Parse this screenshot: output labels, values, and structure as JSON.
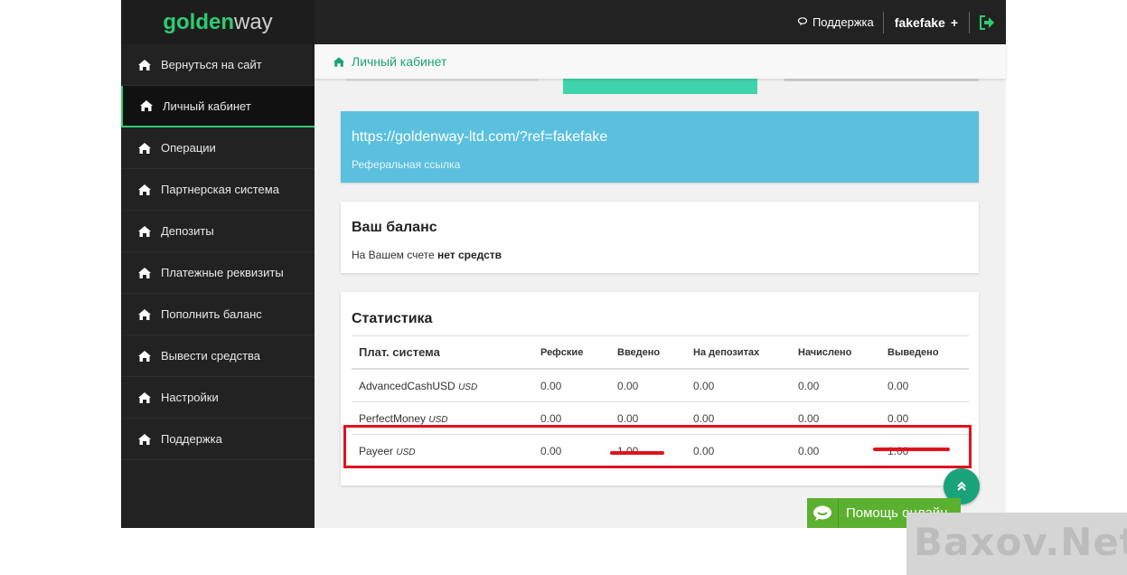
{
  "logo": {
    "part1": "golden",
    "part2": "way"
  },
  "header": {
    "support_label": "Поддержка",
    "username": "fakefake",
    "plus": "+"
  },
  "sidebar": {
    "items": [
      {
        "label": "Вернуться на сайт"
      },
      {
        "label": "Личный кабинет"
      },
      {
        "label": "Операции"
      },
      {
        "label": "Партнерская система"
      },
      {
        "label": "Депозиты"
      },
      {
        "label": "Платежные реквизиты"
      },
      {
        "label": "Пополнить баланс"
      },
      {
        "label": "Вывести средства"
      },
      {
        "label": "Настройки"
      },
      {
        "label": "Поддержка"
      }
    ]
  },
  "breadcrumb": {
    "label": "Личный кабинет"
  },
  "referral": {
    "url": "https://goldenway-ltd.com/?ref=fakefake",
    "label": "Реферальная ссылка"
  },
  "balance": {
    "title": "Ваш баланс",
    "text": "На Вашем счете",
    "value": "нет средств"
  },
  "stats": {
    "title": "Статистика",
    "headers": [
      "Плат. система",
      "Рефские",
      "Введено",
      "На депозитах",
      "Начислено",
      "Выведено"
    ],
    "rows": [
      {
        "system": "AdvancedCashUSD",
        "currency": "USD",
        "values": [
          "0.00",
          "0.00",
          "0.00",
          "0.00",
          "0.00"
        ]
      },
      {
        "system": "PerfectMoney",
        "currency": "USD",
        "values": [
          "0.00",
          "0.00",
          "0.00",
          "0.00",
          "0.00"
        ]
      },
      {
        "system": "Payeer",
        "currency": "USD",
        "values": [
          "0.00",
          "1.00",
          "0.00",
          "0.00",
          "1.00"
        ]
      }
    ]
  },
  "help": {
    "label": "Помощь онлайн"
  },
  "watermark": {
    "text": "Baxov.Net"
  },
  "colors": {
    "accent": "#1aa37a",
    "sidebar_bg": "#222222",
    "info": "#5bc0de",
    "highlight": "#e0121f"
  }
}
